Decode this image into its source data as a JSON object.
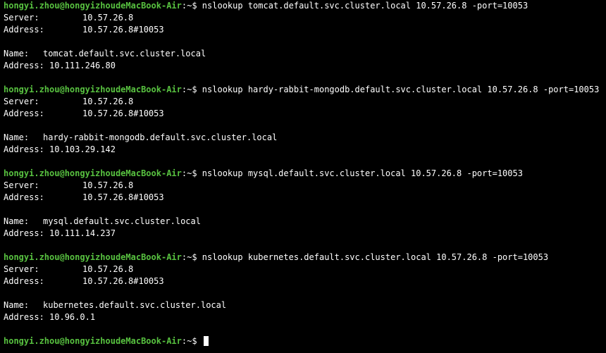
{
  "prompt": {
    "user_host": "hongyi.zhou@hongyizhoudeMacBook-Air",
    "cwd": ":~",
    "symbol": "$"
  },
  "labels": {
    "server": "Server:",
    "address_padded": "Address:",
    "name": "Name:",
    "address": "Address:"
  },
  "commands": [
    {
      "command": "nslookup tomcat.default.svc.cluster.local 10.57.26.8 -port=10053",
      "server": "10.57.26.8",
      "server_address": "10.57.26.8#10053",
      "name": "tomcat.default.svc.cluster.local",
      "address": "10.111.246.80"
    },
    {
      "command": "nslookup hardy-rabbit-mongodb.default.svc.cluster.local 10.57.26.8 -port=10053",
      "server": "10.57.26.8",
      "server_address": "10.57.26.8#10053",
      "name": "hardy-rabbit-mongodb.default.svc.cluster.local",
      "address": "10.103.29.142"
    },
    {
      "command": "nslookup mysql.default.svc.cluster.local 10.57.26.8 -port=10053",
      "server": "10.57.26.8",
      "server_address": "10.57.26.8#10053",
      "name": "mysql.default.svc.cluster.local",
      "address": "10.111.14.237"
    },
    {
      "command": "nslookup kubernetes.default.svc.cluster.local 10.57.26.8 -port=10053",
      "server": "10.57.26.8",
      "server_address": "10.57.26.8#10053",
      "name": "kubernetes.default.svc.cluster.local",
      "address": "10.96.0.1"
    }
  ],
  "colors": {
    "background": "#000000",
    "text": "#ffffff",
    "prompt": "#58c240"
  }
}
